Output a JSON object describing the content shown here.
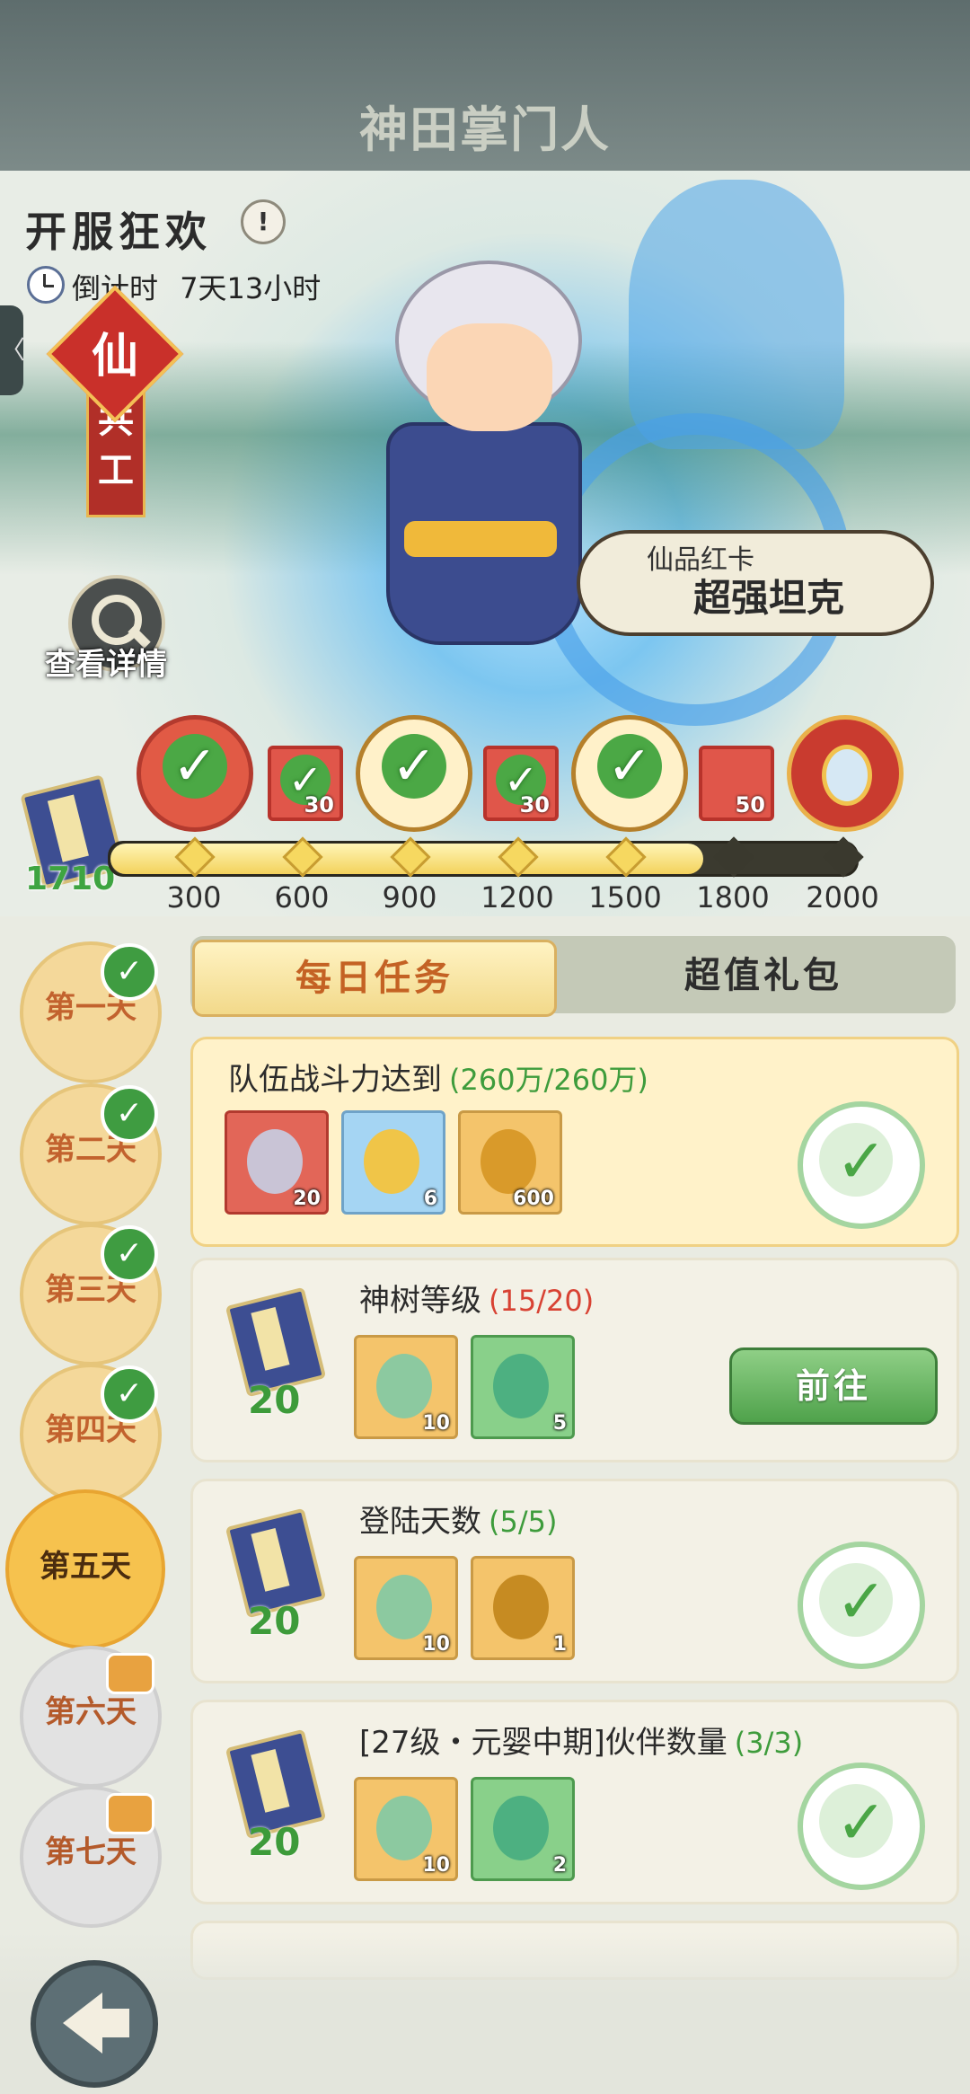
{
  "header": {
    "logo_text": "神田掌门人",
    "event_title": "开服狂欢",
    "info_icon": "exclamation-icon",
    "countdown_label": "倒计时",
    "countdown_value": "7天13小时",
    "edge_arrow": "〈",
    "badge_char": "仙",
    "ribbon_text": "共\n工",
    "detail_label": "查看详情"
  },
  "promo": {
    "bubble_small": "仙品红卡",
    "bubble_big": "超强坦克"
  },
  "progress": {
    "current_points": "1710",
    "current_value": 1710,
    "max_value": 2000,
    "milestones": [
      "300",
      "600",
      "900",
      "1200",
      "1500",
      "1800",
      "2000"
    ],
    "rewards": [
      {
        "type": "hero-portrait",
        "claimed": true,
        "qty": ""
      },
      {
        "type": "hero-card",
        "claimed": true,
        "qty": "30"
      },
      {
        "type": "golden-frame",
        "claimed": true,
        "qty": ""
      },
      {
        "type": "hero-card",
        "claimed": true,
        "qty": "30"
      },
      {
        "type": "helmet",
        "claimed": true,
        "qty": ""
      },
      {
        "type": "hero-card",
        "claimed": false,
        "qty": "50"
      },
      {
        "type": "magic-mirror",
        "claimed": false,
        "qty": ""
      }
    ]
  },
  "tabs": {
    "daily": "每日任务",
    "gift": "超值礼包"
  },
  "days": [
    {
      "label": "第一天",
      "state": "done"
    },
    {
      "label": "第二天",
      "state": "done"
    },
    {
      "label": "第三天",
      "state": "done"
    },
    {
      "label": "第四天",
      "state": "done"
    },
    {
      "label": "第五天",
      "state": "active"
    },
    {
      "label": "第六天",
      "state": "locked"
    },
    {
      "label": "第七天",
      "state": "locked"
    }
  ],
  "tasks": [
    {
      "title": "队伍战斗力达到",
      "progress": "(260万/260万)",
      "progress_color": "#3e9c3c",
      "status": "done",
      "items": [
        {
          "kind": "red",
          "icon": "hero-card-icon",
          "qty": "20"
        },
        {
          "kind": "blue",
          "icon": "golden-egg-icon",
          "qty": "6"
        },
        {
          "kind": "gold",
          "icon": "golden-orb-icon",
          "qty": "600"
        }
      ]
    },
    {
      "title": "神树等级",
      "progress": "(15/20)",
      "progress_color": "#d84233",
      "status": "go",
      "points": "20",
      "button": "前往",
      "items": [
        {
          "kind": "gold",
          "icon": "jade-dragon-icon",
          "qty": "10"
        },
        {
          "kind": "green",
          "icon": "jade-orb-icon",
          "qty": "5"
        }
      ]
    },
    {
      "title": "登陆天数",
      "progress": "(5/5)",
      "progress_color": "#3e9c3c",
      "status": "done",
      "points": "20",
      "items": [
        {
          "kind": "gold",
          "icon": "jade-dragon-icon",
          "qty": "10"
        },
        {
          "kind": "gold",
          "icon": "golden-seal-icon",
          "qty": "1"
        }
      ]
    },
    {
      "title": "[27级・元婴中期]伙伴数量",
      "progress": "(3/3)",
      "progress_color": "#3e9c3c",
      "status": "done",
      "points": "20",
      "items": [
        {
          "kind": "gold",
          "icon": "jade-dragon-icon",
          "qty": "10"
        },
        {
          "kind": "green",
          "icon": "jade-orb-icon",
          "qty": "2"
        }
      ]
    }
  ],
  "colors": {
    "accent_orange": "#c46224",
    "claimed_green": "#4ba845"
  },
  "nav": {
    "back_icon": "back-arrow-icon"
  }
}
